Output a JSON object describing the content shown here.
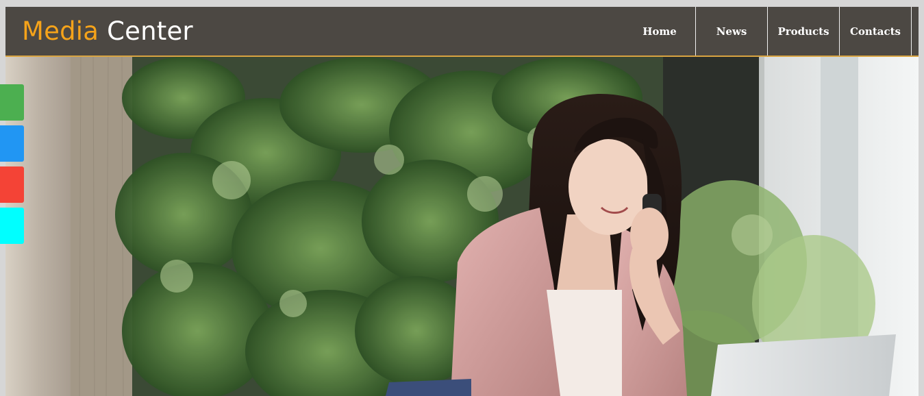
{
  "logo": {
    "word1": "Media",
    "word2": "Center",
    "accent_color": "#f5a31a",
    "text_color": "#ffffff"
  },
  "header": {
    "background": "#4c4843",
    "border_color": "#d9a441"
  },
  "nav": {
    "items": [
      {
        "label": "Home"
      },
      {
        "label": "News"
      },
      {
        "label": "Products"
      },
      {
        "label": "Contacts"
      }
    ]
  },
  "hero": {
    "image_icon": "hero-photo-woman-on-phone"
  },
  "side_tabs": [
    {
      "color": "#4caf50"
    },
    {
      "color": "#2196f3"
    },
    {
      "color": "#f44336"
    },
    {
      "color": "#00ffff"
    }
  ]
}
